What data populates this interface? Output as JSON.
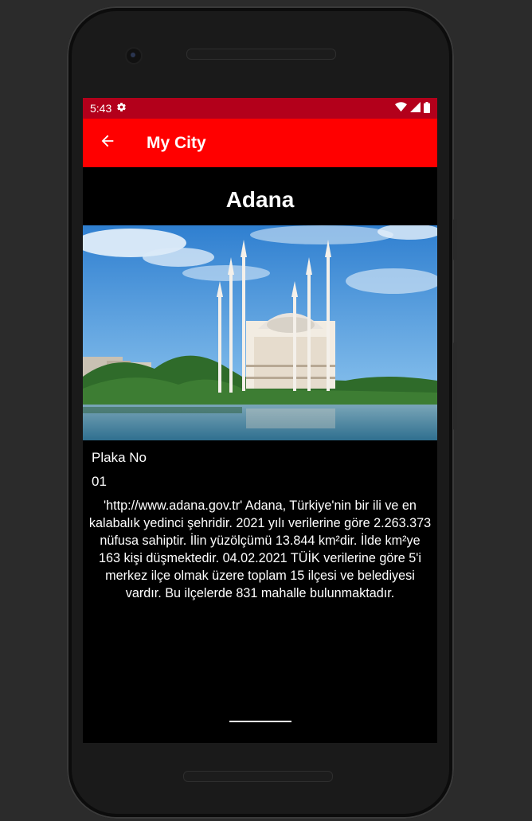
{
  "status_bar": {
    "time": "5:43",
    "icons": [
      "settings-icon",
      "wifi-icon",
      "signal-icon",
      "battery-icon"
    ],
    "background": "#b3001b"
  },
  "app_bar": {
    "title": "My City",
    "back_icon": "arrow-back-icon",
    "background": "#ff0000"
  },
  "city": {
    "name": "Adana",
    "image": "mosque-by-lake-photo",
    "plate_label": "Plaka No",
    "plate_value": "01",
    "description": "'http://www.adana.gov.tr' Adana, Türkiye'nin bir ili ve en kalabalık yedinci şehridir. 2021 yılı verilerine göre 2.263.373 nüfusa sahiptir. İlin yüzölçümü 13.844 km²dir. İlde km²ye 163 kişi düşmektedir. 04.02.2021 TÜİK verilerine göre 5'i merkez ilçe olmak üzere toplam 15 ilçesi ve belediyesi vardır. Bu ilçelerde 831 mahalle bulunmaktadır."
  }
}
